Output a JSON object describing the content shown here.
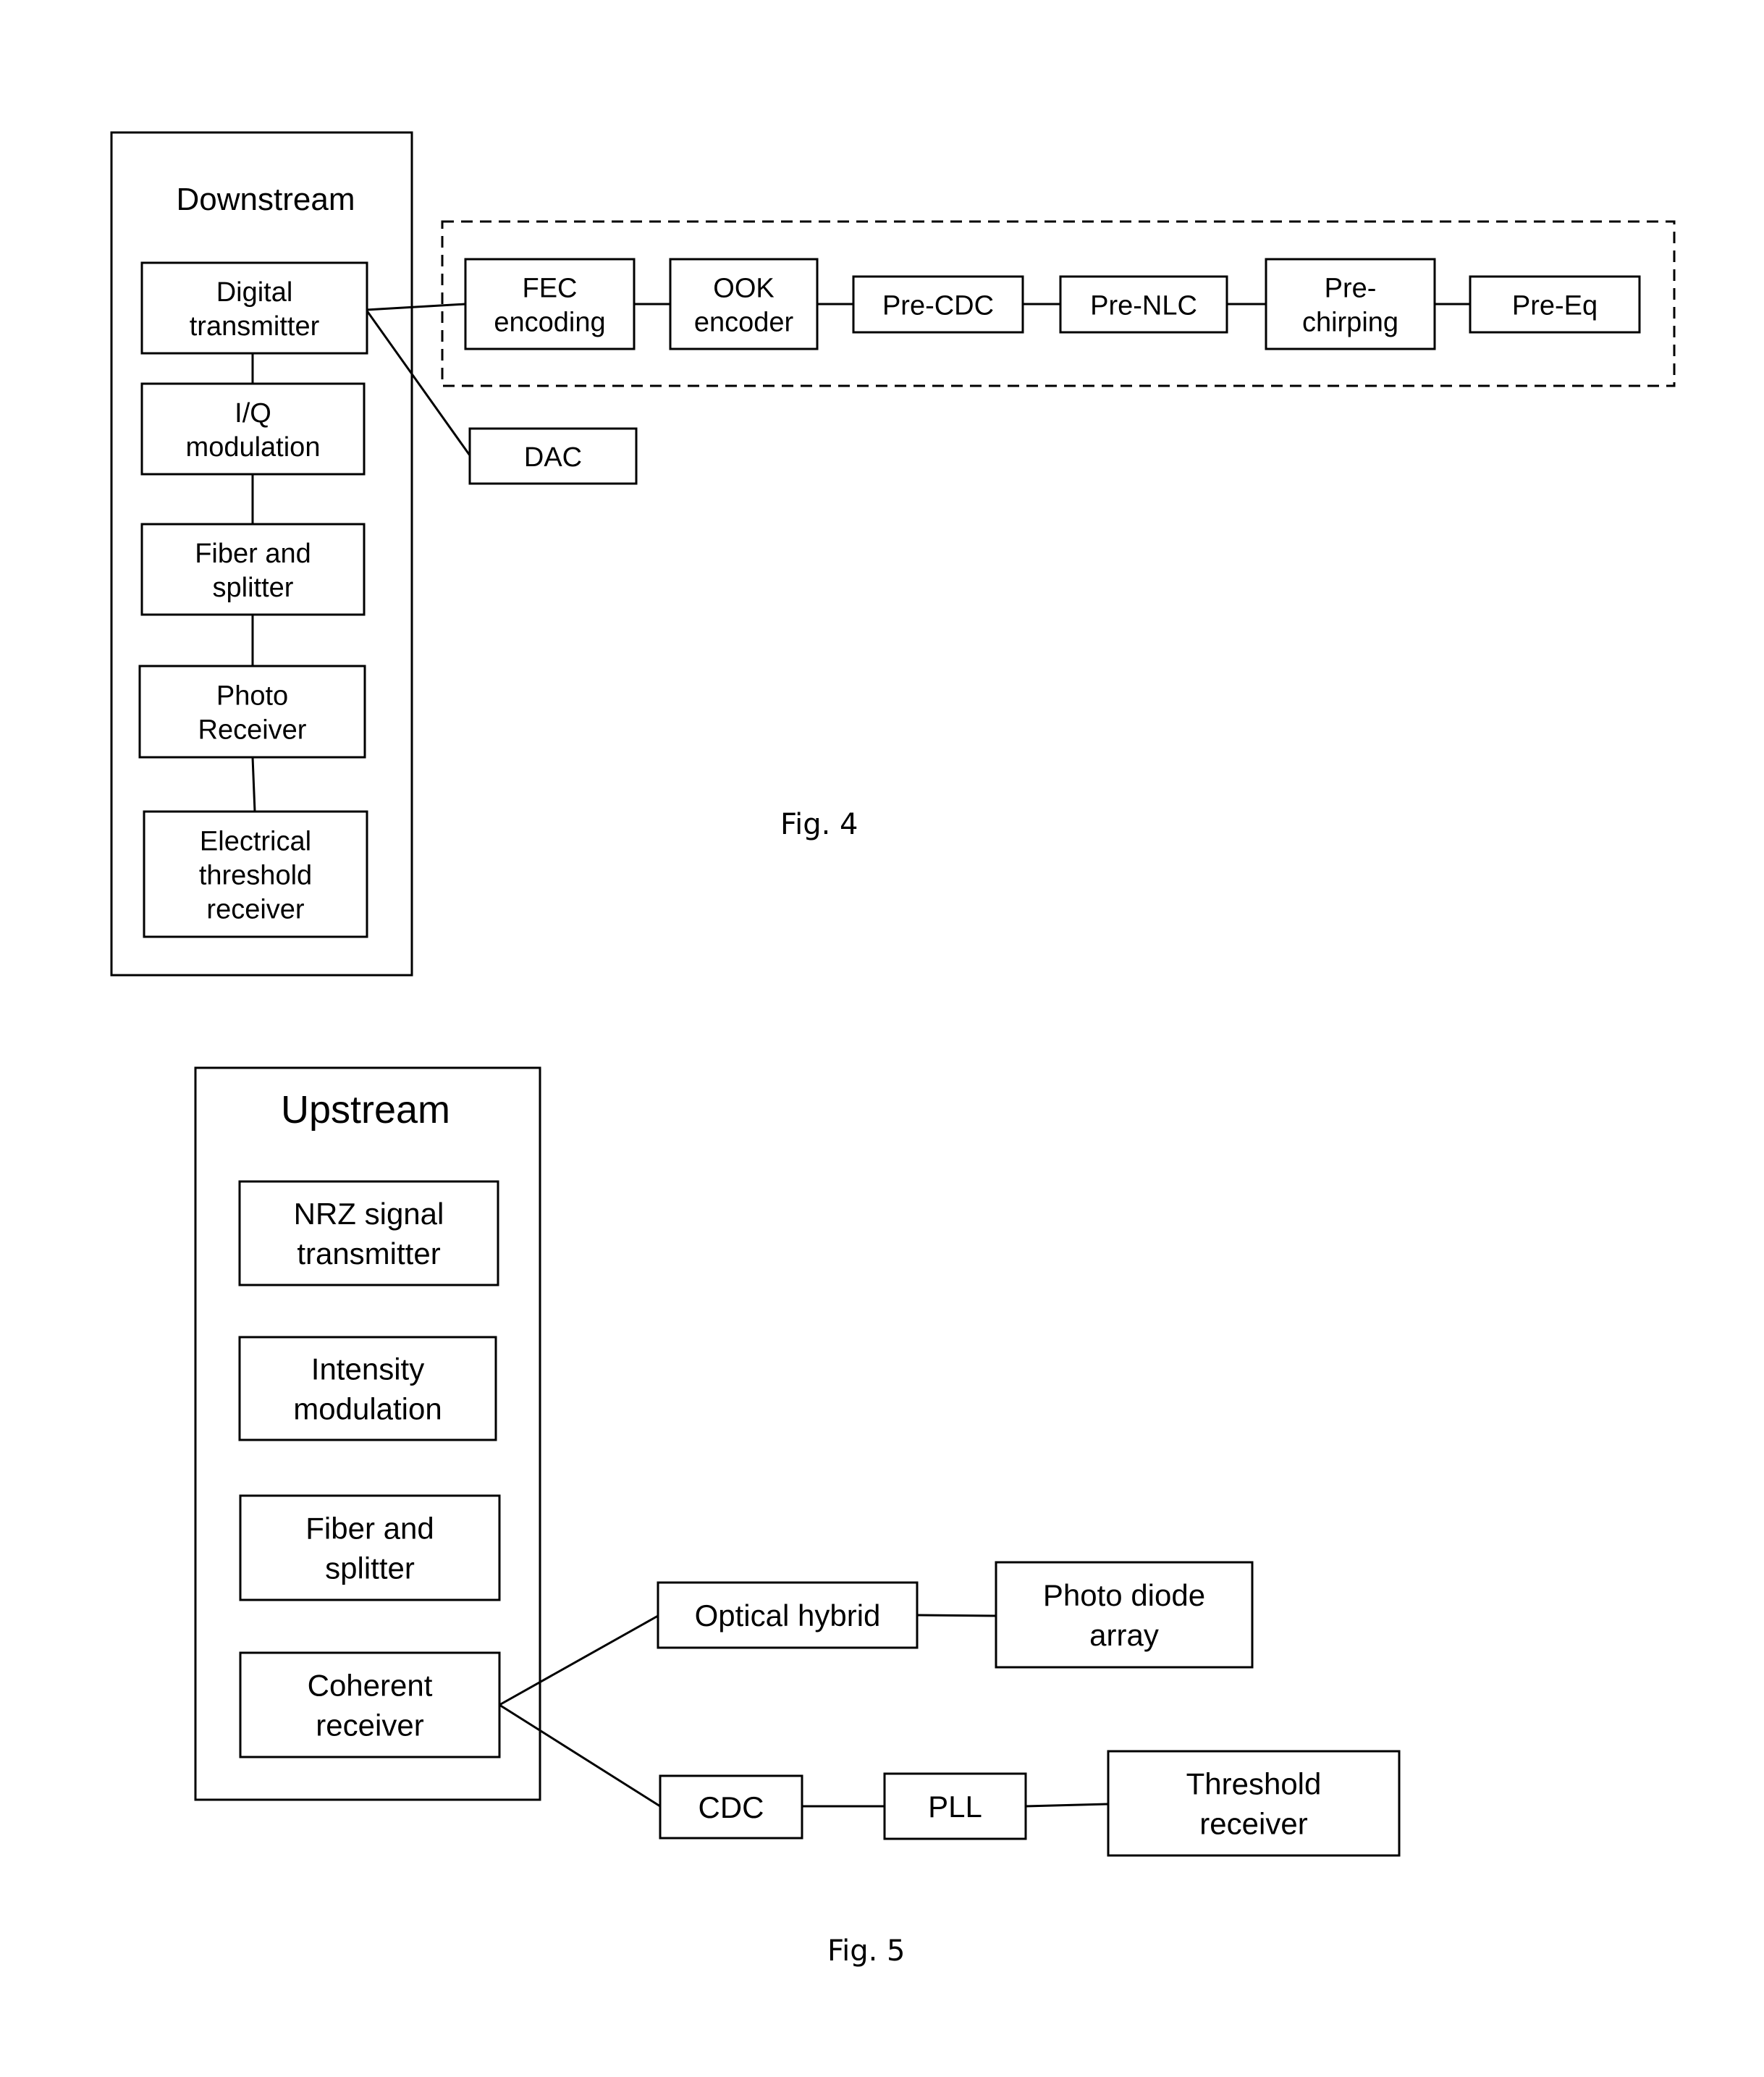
{
  "figure4": {
    "caption": "Fig. 4",
    "group_title": "Downstream",
    "chain": [
      {
        "id": "digital-transmitter",
        "lines": [
          "Digital",
          "transmitter"
        ]
      },
      {
        "id": "iq-modulation",
        "lines": [
          "I/Q",
          "modulation"
        ]
      },
      {
        "id": "fiber-and-splitter",
        "lines": [
          "Fiber and",
          "splitter"
        ]
      },
      {
        "id": "photo-receiver",
        "lines": [
          "Photo",
          "Receiver"
        ]
      },
      {
        "id": "electrical-threshold-receiver",
        "lines": [
          "Electrical",
          "threshold",
          "receiver"
        ]
      }
    ],
    "dsp_group": [
      {
        "id": "fec-encoding",
        "lines": [
          "FEC",
          "encoding"
        ]
      },
      {
        "id": "ook-encoder",
        "lines": [
          "OOK",
          "encoder"
        ]
      },
      {
        "id": "pre-cdc",
        "lines": [
          "Pre-CDC"
        ]
      },
      {
        "id": "pre-nlc",
        "lines": [
          "Pre-NLC"
        ]
      },
      {
        "id": "pre-chirping",
        "lines": [
          "Pre-",
          "chirping"
        ]
      },
      {
        "id": "pre-eq",
        "lines": [
          "Pre-Eq"
        ]
      }
    ],
    "dac": {
      "id": "dac",
      "lines": [
        "DAC"
      ]
    }
  },
  "figure5": {
    "caption": "Fig. 5",
    "group_title": "Upstream",
    "chain": [
      {
        "id": "nrz-signal-transmitter",
        "lines": [
          "NRZ signal",
          "transmitter"
        ]
      },
      {
        "id": "intensity-modulation",
        "lines": [
          "Intensity",
          "modulation"
        ]
      },
      {
        "id": "fiber-and-splitter",
        "lines": [
          "Fiber and",
          "splitter"
        ]
      },
      {
        "id": "coherent-receiver",
        "lines": [
          "Coherent",
          "receiver"
        ]
      }
    ],
    "upper_branch": [
      {
        "id": "optical-hybrid",
        "lines": [
          "Optical hybrid"
        ]
      },
      {
        "id": "photo-diode-array",
        "lines": [
          "Photo diode",
          "array"
        ]
      }
    ],
    "lower_branch": [
      {
        "id": "cdc",
        "lines": [
          "CDC"
        ]
      },
      {
        "id": "pll",
        "lines": [
          "PLL"
        ]
      },
      {
        "id": "threshold-receiver",
        "lines": [
          "Threshold",
          "receiver"
        ]
      }
    ]
  }
}
